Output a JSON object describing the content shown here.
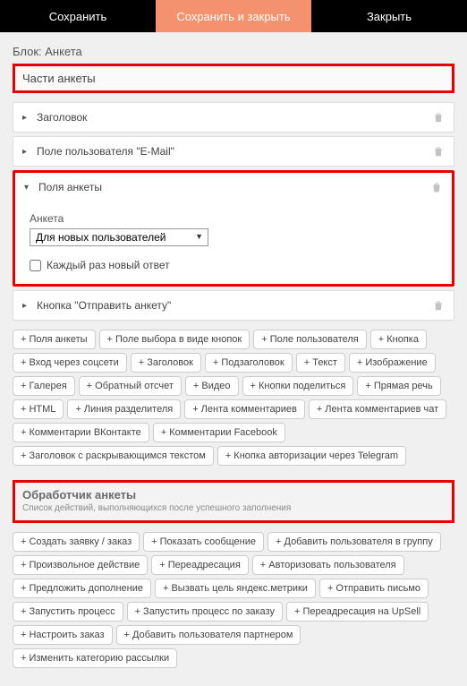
{
  "topbar": {
    "save": "Сохранить",
    "saveClose": "Сохранить и закрыть",
    "close": "Закрыть"
  },
  "blockTitle": "Блок: Анкета",
  "partsHeader": "Части анкеты",
  "items": {
    "header": "Заголовок",
    "emailField": "Поле пользователя \"E-Mail\"",
    "formFields": "Поля анкеты",
    "submitBtn": "Кнопка \"Отправить анкету\""
  },
  "formFieldsBody": {
    "label": "Анкета",
    "selectValue": "Для новых пользователей",
    "checkboxLabel": "Каждый раз новый ответ"
  },
  "addChips": [
    "+ Поля анкеты",
    "+ Поле выбора в виде кнопок",
    "+ Поле пользователя",
    "+ Кнопка",
    "+ Вход через соцсети",
    "+ Заголовок",
    "+ Подзаголовок",
    "+ Текст",
    "+ Изображение",
    "+ Галерея",
    "+ Обратный отсчет",
    "+ Видео",
    "+ Кнопки поделиться",
    "+ Прямая речь",
    "+ HTML",
    "+ Линия разделителя",
    "+ Лента комментариев",
    "+ Лента комментариев чат",
    "+ Комментарии ВКонтакте",
    "+ Комментарии Facebook",
    "+ Заголовок с раскрывающимся текстом",
    "+ Кнопка авторизации через Telegram"
  ],
  "handler": {
    "title": "Обработчик анкеты",
    "sub": "Список действий, выполняющихся после успешного заполнения"
  },
  "handlerChips": [
    "+ Создать заявку / заказ",
    "+ Показать сообщение",
    "+ Добавить пользователя в группу",
    "+ Произвольное действие",
    "+ Переадресация",
    "+ Авторизовать пользователя",
    "+ Предложить дополнение",
    "+ Вызвать цель яндекс.метрики",
    "+ Отправить письмо",
    "+ Запустить процесс",
    "+ Запустить процесс по заказу",
    "+ Переадресация на UpSell",
    "+ Настроить заказ",
    "+ Добавить пользователя партнером",
    "+ Изменить категорию рассылки"
  ]
}
